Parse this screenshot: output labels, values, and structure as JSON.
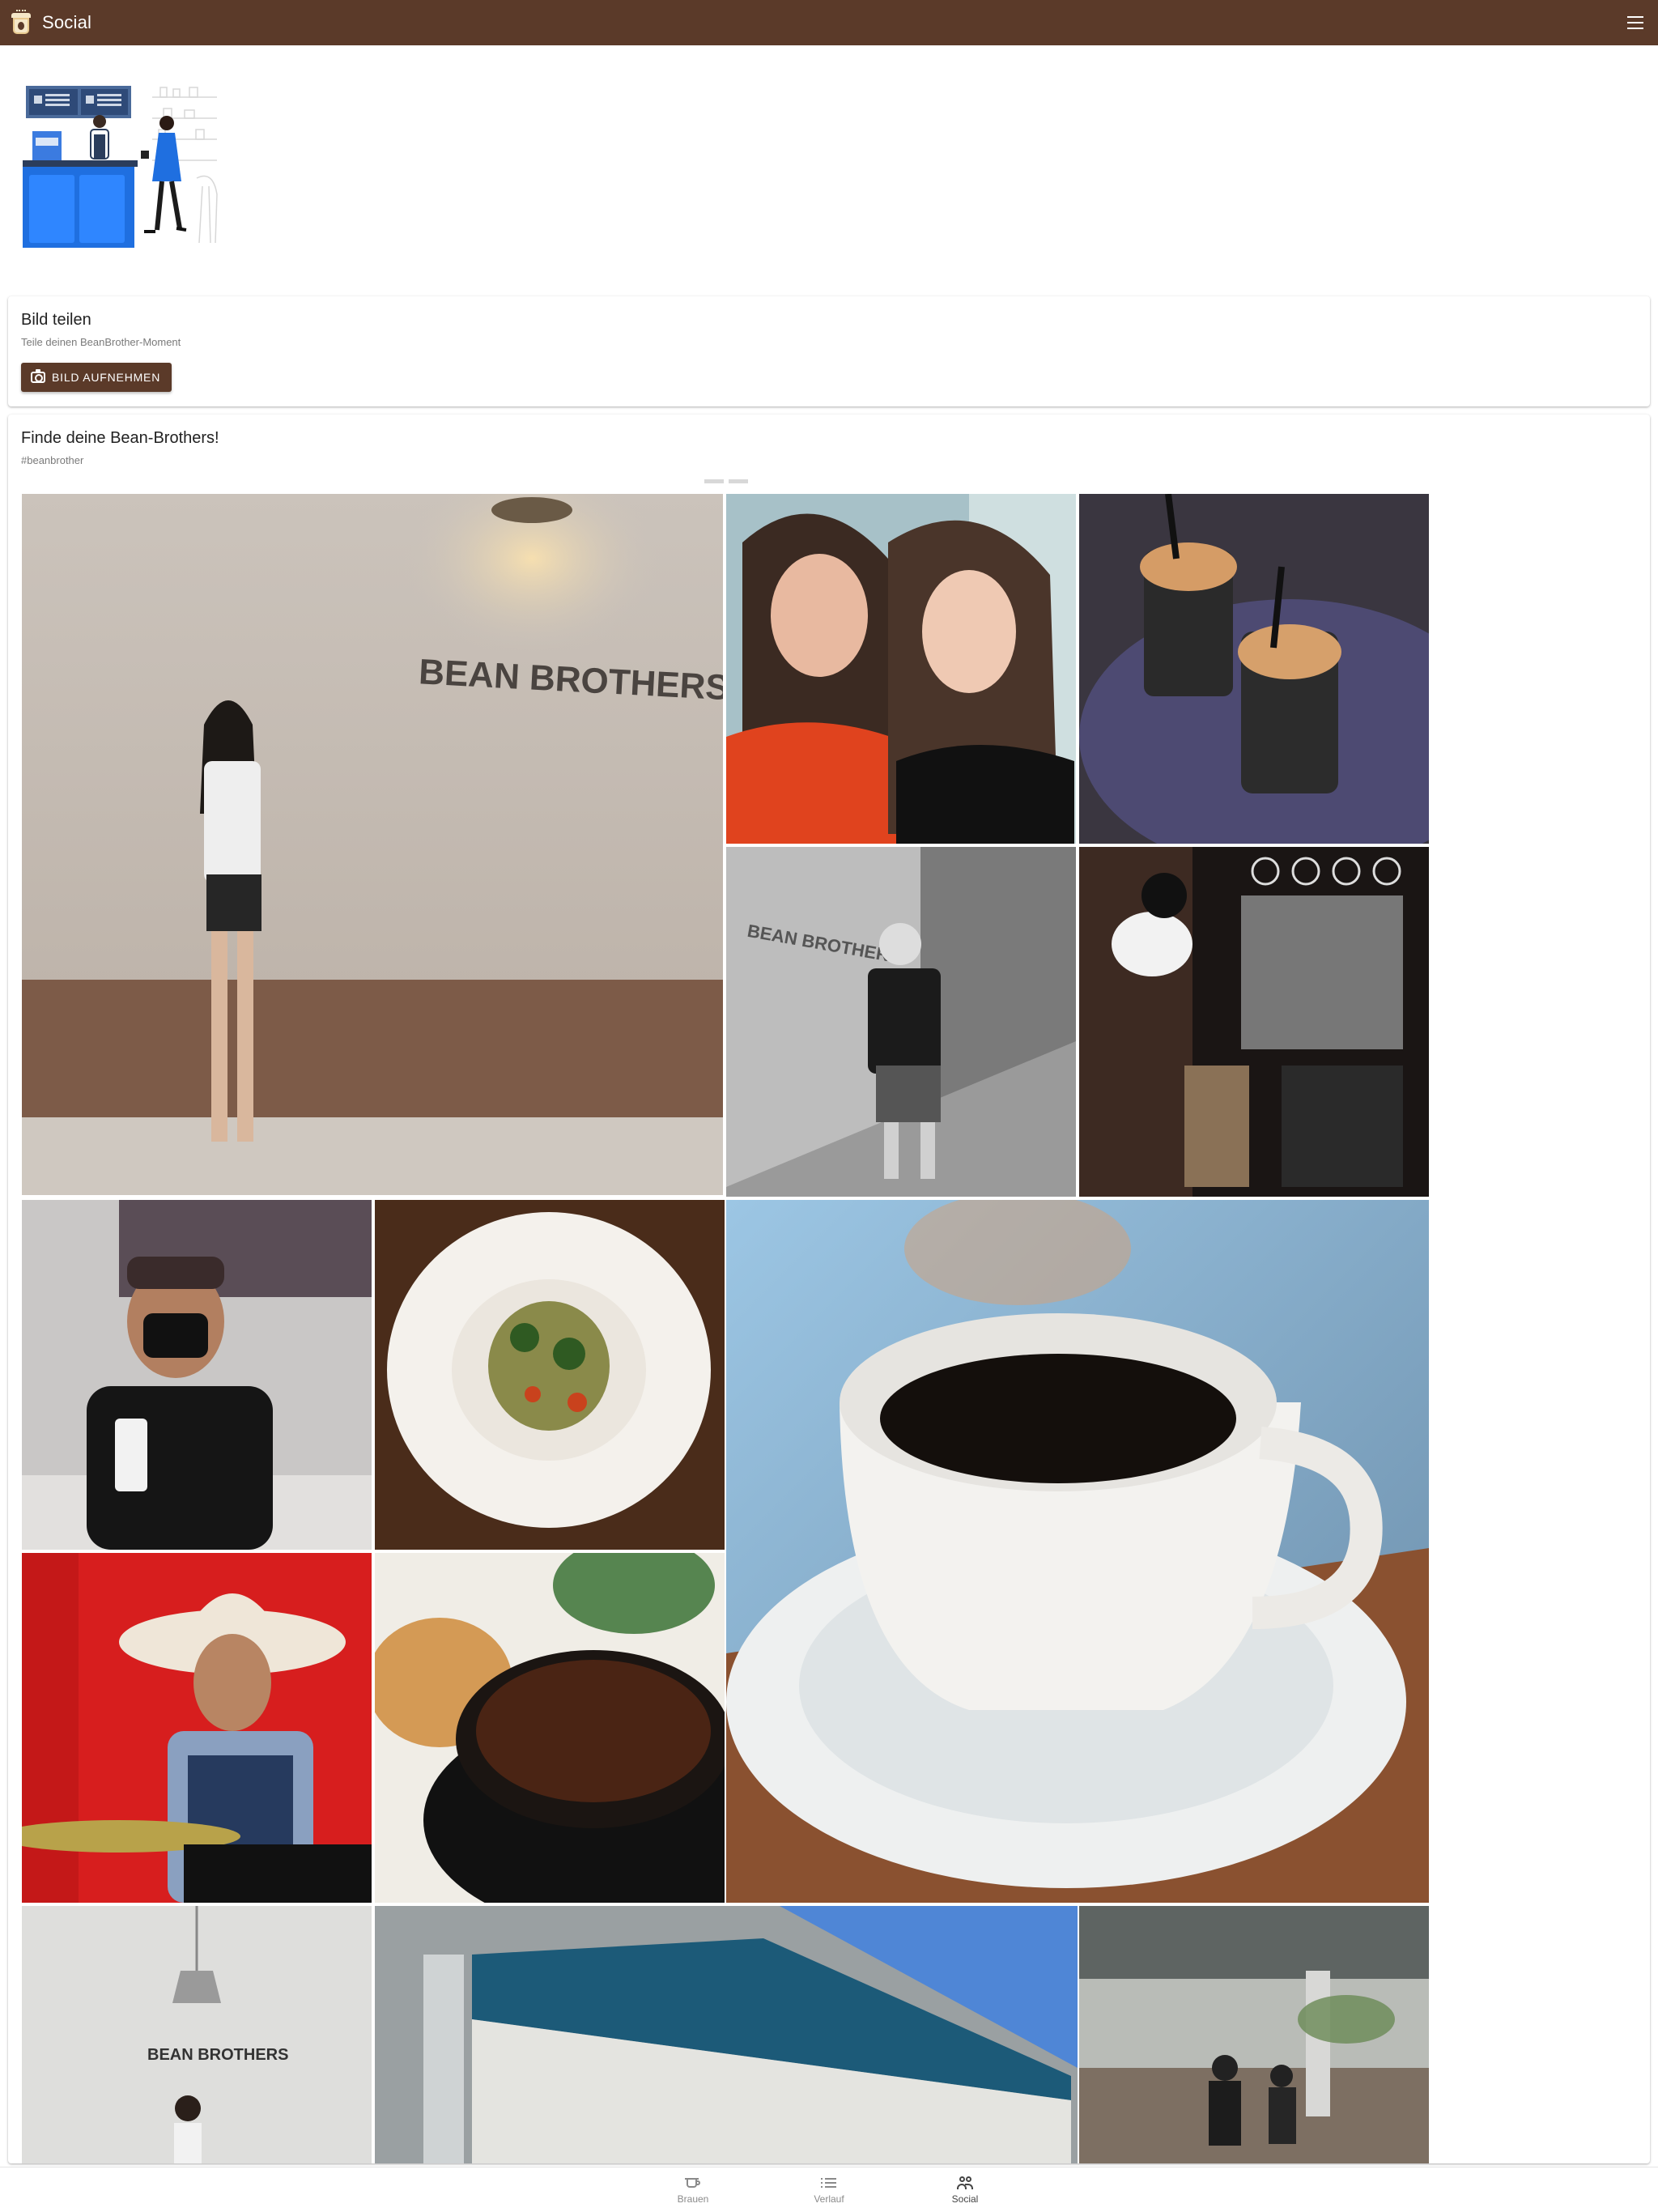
{
  "appbar": {
    "title": "Social",
    "logo_icon": "coffee-cup-logo-icon",
    "menu_icon": "hamburger-menu-icon",
    "background_color": "#5b3a29"
  },
  "hero": {
    "illustration": "coffee-shop-barista-illustration"
  },
  "share_card": {
    "title": "Bild teilen",
    "subtitle": "Teile deinen BeanBrother-Moment",
    "button_label": "BILD AUFNEHMEN",
    "button_icon": "camera-icon"
  },
  "feed_card": {
    "title": "Finde deine Bean-Brothers!",
    "hashtag": "#beanbrother",
    "photos": [
      {
        "name": "photo-woman-bean-brothers-wall",
        "sign_text": "BEAN BROTHERS"
      },
      {
        "name": "photo-two-women-selfie"
      },
      {
        "name": "photo-iced-coffees-on-table"
      },
      {
        "name": "photo-man-walking-bean-brothers-wall",
        "sign_text": "BEAN BROTHERS"
      },
      {
        "name": "photo-barista-top-view"
      },
      {
        "name": "photo-man-with-mask-and-cup"
      },
      {
        "name": "photo-pasta-plate"
      },
      {
        "name": "photo-espresso-cup-closeup"
      },
      {
        "name": "photo-cowboy-drummer"
      },
      {
        "name": "photo-coffee-and-muffin"
      },
      {
        "name": "photo-woman-under-lamp",
        "sign_text": "BEAN BROTHERS"
      },
      {
        "name": "photo-building-exterior"
      },
      {
        "name": "photo-cafe-interior"
      }
    ]
  },
  "bottom_nav": {
    "items": [
      {
        "label": "Brauen",
        "icon": "coffee-cup-icon",
        "active": false
      },
      {
        "label": "Verlauf",
        "icon": "list-icon",
        "active": false
      },
      {
        "label": "Social",
        "icon": "people-icon",
        "active": true
      }
    ]
  }
}
